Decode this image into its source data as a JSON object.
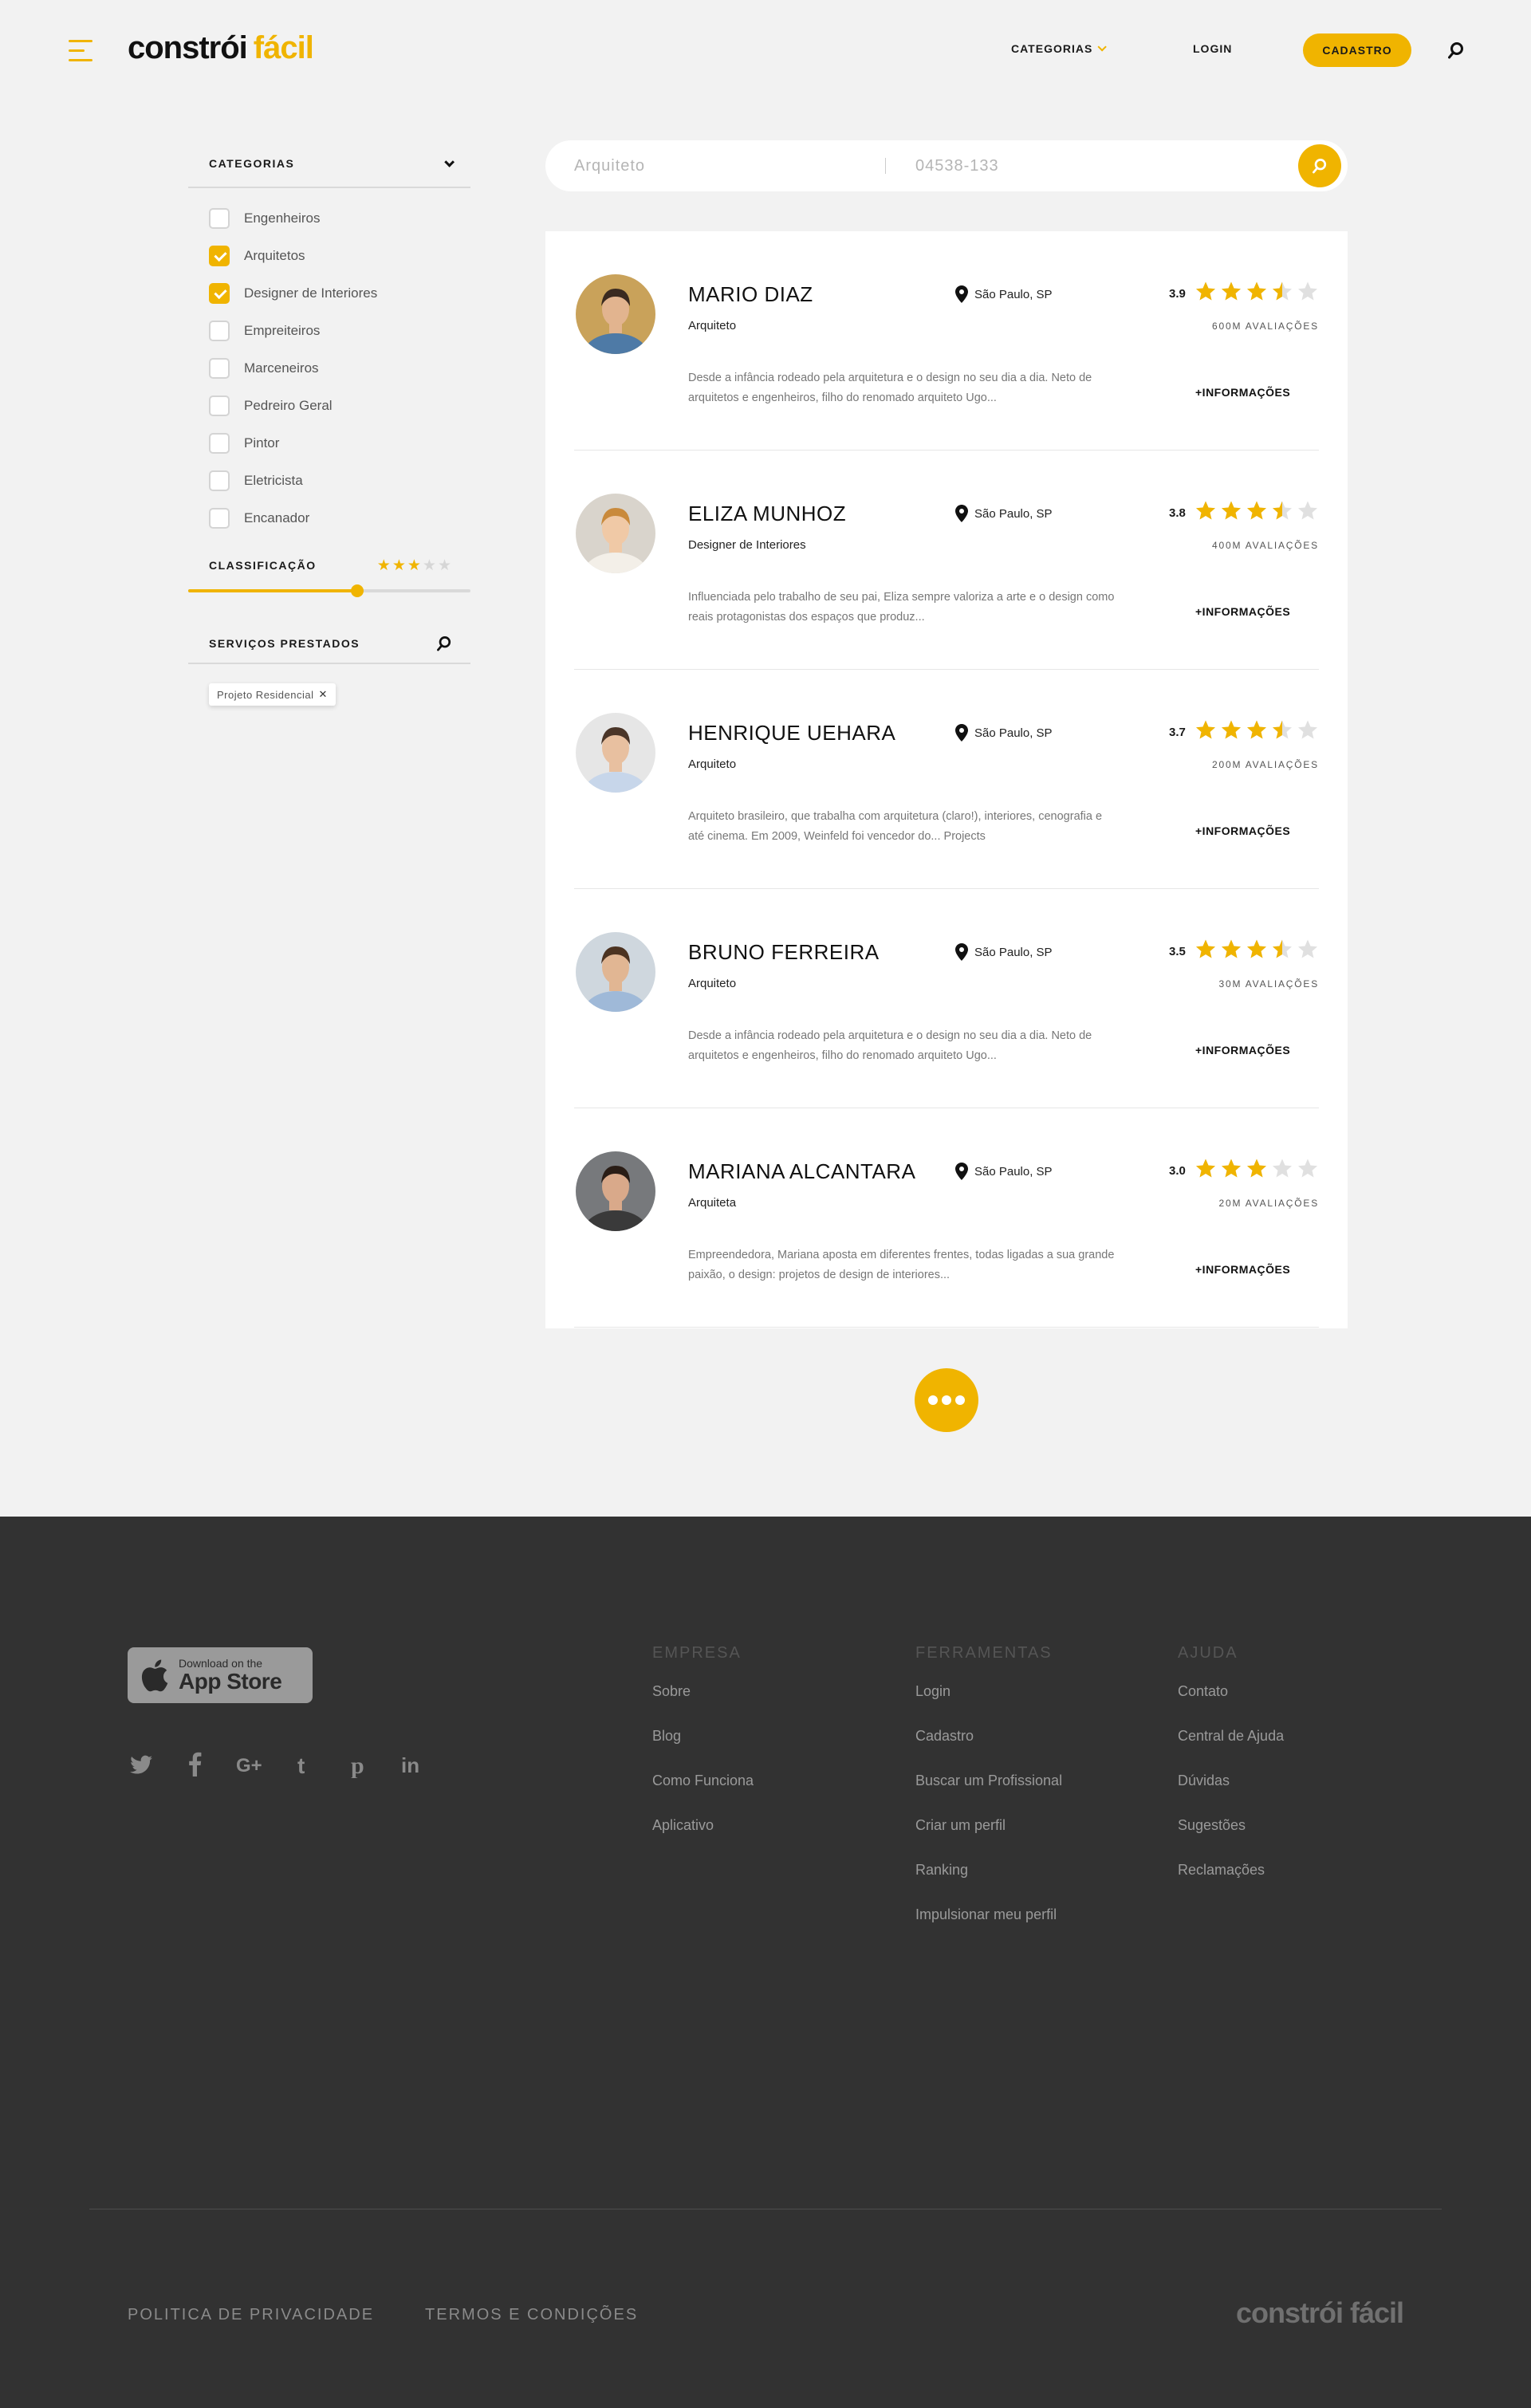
{
  "brand": {
    "name_part1": "constrói",
    "name_part2": "fácil",
    "accent": "#f0b400"
  },
  "header": {
    "nav": {
      "categorias": "CATEGORIAS",
      "login": "LOGIN",
      "cadastro": "CADASTRO"
    }
  },
  "sidebar": {
    "categorias_title": "CATEGORIAS",
    "categories": [
      {
        "label": "Engenheiros",
        "checked": false
      },
      {
        "label": "Arquitetos",
        "checked": true
      },
      {
        "label": "Designer de Interiores",
        "checked": true
      },
      {
        "label": "Empreiteiros",
        "checked": false
      },
      {
        "label": "Marceneiros",
        "checked": false
      },
      {
        "label": "Pedreiro Geral",
        "checked": false
      },
      {
        "label": "Pintor",
        "checked": false
      },
      {
        "label": "Eletricista",
        "checked": false
      },
      {
        "label": "Encanador",
        "checked": false
      }
    ],
    "classificacao_title": "CLASSIFICAÇÃO",
    "classificacao_stars": 3,
    "classificacao_max": 5,
    "slider_fraction": 0.6,
    "servicos_title": "SERVIÇOS PRESTADOS",
    "tags": [
      "Projeto Residencial"
    ]
  },
  "search": {
    "placeholder_query": "Arquiteto",
    "placeholder_cep": "04538-133"
  },
  "professionals": [
    {
      "name": "MARIO DIAZ",
      "role": "Arquiteto",
      "location": "São Paulo, SP",
      "rating": "3.9",
      "stars": 3.5,
      "reviews": "600M AVALIAÇÕES",
      "description": "Desde a infância rodeado pela arquitetura e o design no seu dia a dia. Neto de arquitetos e engenheiros, filho do renomado arquiteto Ugo...",
      "more": "+INFORMAÇÕES"
    },
    {
      "name": "ELIZA MUNHOZ",
      "role": "Designer de Interiores",
      "location": "São Paulo, SP",
      "rating": "3.8",
      "stars": 3.5,
      "reviews": "400M AVALIAÇÕES",
      "description": "Influenciada pelo trabalho de seu pai, Eliza sempre valoriza a arte e o design como reais protagonistas dos espaços que produz...",
      "more": "+INFORMAÇÕES"
    },
    {
      "name": "HENRIQUE UEHARA",
      "role": "Arquiteto",
      "location": "São Paulo, SP",
      "rating": "3.7",
      "stars": 3.5,
      "reviews": "200M AVALIAÇÕES",
      "description": "Arquiteto brasileiro, que trabalha com arquitetura (claro!), interiores, cenografia e até cinema. Em 2009, Weinfeld foi vencedor do... Projects",
      "more": "+INFORMAÇÕES"
    },
    {
      "name": "BRUNO FERREIRA",
      "role": "Arquiteto",
      "location": "São Paulo, SP",
      "rating": "3.5",
      "stars": 3.5,
      "reviews": "30M AVALIAÇÕES",
      "description": "Desde a infância rodeado pela arquitetura e o design no seu dia a dia. Neto de arquitetos e engenheiros, filho do renomado arquiteto Ugo...",
      "more": "+INFORMAÇÕES"
    },
    {
      "name": "MARIANA ALCANTARA",
      "role": "Arquiteta",
      "location": "São Paulo, SP",
      "rating": "3.0",
      "stars": 3,
      "reviews": "20M AVALIAÇÕES",
      "description": "Empreendedora, Mariana aposta em diferentes frentes, todas ligadas a sua grande paixão, o design: projetos de design de interiores...",
      "more": "+INFORMAÇÕES"
    }
  ],
  "footer": {
    "appstore": {
      "line1": "Download on the",
      "line2": "App Store"
    },
    "columns": [
      {
        "title": "EMPRESA",
        "links": [
          "Sobre",
          "Blog",
          "Como Funciona",
          "Aplicativo"
        ]
      },
      {
        "title": "FERRAMENTAS",
        "links": [
          "Login",
          "Cadastro",
          "Buscar um Profissional",
          "Criar um perfil",
          "Ranking",
          "Impulsionar meu perfil"
        ]
      },
      {
        "title": "AJUDA",
        "links": [
          "Contato",
          "Central de Ajuda",
          "Dúvidas",
          "Sugestões",
          "Reclamações"
        ]
      }
    ],
    "bottom_links": [
      "POLITICA DE PRIVACIDADE",
      "TERMOS E CONDIÇÕES"
    ],
    "logo": "constrói fácil"
  }
}
